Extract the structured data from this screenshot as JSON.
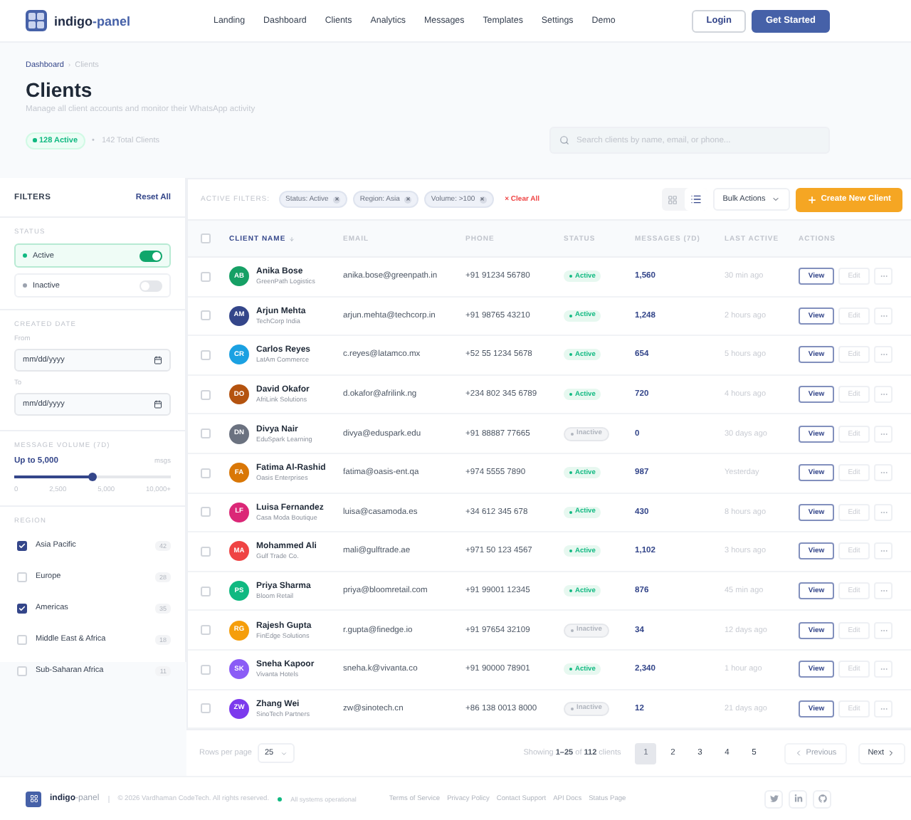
{
  "brand": {
    "first": "indigo",
    "second": "-panel"
  },
  "nav": [
    "Landing",
    "Dashboard",
    "Clients",
    "Analytics",
    "Messages",
    "Templates",
    "Settings",
    "Demo"
  ],
  "header_buttons": {
    "login": "Login",
    "start": "Get Started"
  },
  "breadcrumb": {
    "items": [
      "Dashboard",
      "Clients"
    ],
    "separator": "›"
  },
  "page": {
    "title": "Clients",
    "subtitle": "Manage all client accounts and monitor their WhatsApp activity",
    "active_badge": "128 Active",
    "dot": "•",
    "total": "142 Total Clients"
  },
  "search": {
    "placeholder": "Search clients by name, email, or phone..."
  },
  "filters": {
    "title": "FILTERS",
    "reset": "Reset All",
    "status": {
      "label": "STATUS",
      "options": [
        {
          "label": "Active",
          "on": true,
          "color": "#10b981"
        },
        {
          "label": "Inactive",
          "on": false,
          "color": "#9ca3af"
        }
      ]
    },
    "date": {
      "label": "CREATED DATE",
      "fields": [
        {
          "label": "From",
          "placeholder": "mm/dd/yyyy"
        },
        {
          "label": "To",
          "placeholder": "mm/dd/yyyy"
        }
      ]
    },
    "volume": {
      "label": "MESSAGE VOLUME (7D)",
      "value": "Up to 5,000",
      "unit": "msgs",
      "level": 0.5,
      "ticks": [
        "0",
        "2,500",
        "5,000",
        "10,000+"
      ]
    },
    "region": {
      "label": "REGION",
      "items": [
        {
          "label": "Asia Pacific",
          "checked": true,
          "count": "42"
        },
        {
          "label": "Europe",
          "checked": false,
          "count": "28"
        },
        {
          "label": "Americas",
          "checked": true,
          "count": "35"
        },
        {
          "label": "Middle East & Africa",
          "checked": false,
          "count": "18"
        },
        {
          "label": "Sub-Saharan Africa",
          "checked": false,
          "count": "11"
        }
      ]
    }
  },
  "toolbar": {
    "label": "ACTIVE FILTERS:",
    "chips": [
      "Status: Active",
      "Region: Asia",
      "Volume: >100"
    ],
    "clear": "× Clear All",
    "views": [
      {
        "kind": "grid",
        "selected": false
      },
      {
        "kind": "list",
        "selected": true
      }
    ],
    "bulk": "Bulk Actions",
    "create": "Create New Client"
  },
  "table": {
    "select_all_checked": false,
    "columns": [
      "CLIENT NAME",
      "EMAIL",
      "PHONE",
      "STATUS",
      "MESSAGES (7D)",
      "LAST ACTIVE",
      "ACTIONS"
    ],
    "rows": [
      {
        "checked": false,
        "initials": "AB",
        "color": "#16a065",
        "name": "Anika Bose",
        "company": "GreenPath Logistics",
        "email": "anika.bose@greenpath.in",
        "phone": "+91 91234 56780",
        "status": "Active",
        "active": true,
        "messages": "1,560",
        "last_active": "30 min ago",
        "view": "View",
        "edit": "Edit"
      },
      {
        "checked": false,
        "initials": "AM",
        "color": "#34468a",
        "name": "Arjun Mehta",
        "company": "TechCorp India",
        "email": "arjun.mehta@techcorp.in",
        "phone": "+91 98765 43210",
        "status": "Active",
        "active": true,
        "messages": "1,248",
        "last_active": "2 hours ago",
        "view": "View",
        "edit": "Edit"
      },
      {
        "checked": false,
        "initials": "CR",
        "color": "#1ba1e2",
        "name": "Carlos Reyes",
        "company": "LatAm Commerce",
        "email": "c.reyes@latamco.mx",
        "phone": "+52 55 1234 5678",
        "status": "Active",
        "active": true,
        "messages": "654",
        "last_active": "5 hours ago",
        "view": "View",
        "edit": "Edit"
      },
      {
        "checked": false,
        "initials": "DO",
        "color": "#b4530f",
        "name": "David Okafor",
        "company": "AfriLink Solutions",
        "email": "d.okafor@afrilink.ng",
        "phone": "+234 802 345 6789",
        "status": "Active",
        "active": true,
        "messages": "720",
        "last_active": "4 hours ago",
        "view": "View",
        "edit": "Edit"
      },
      {
        "checked": false,
        "initials": "DN",
        "color": "#6b7280",
        "name": "Divya Nair",
        "company": "EduSpark Learning",
        "email": "divya@eduspark.edu",
        "phone": "+91 88887 77665",
        "status": "Inactive",
        "active": false,
        "messages": "0",
        "last_active": "30 days ago",
        "view": "View",
        "edit": "Edit"
      },
      {
        "checked": false,
        "initials": "FA",
        "color": "#d97706",
        "name": "Fatima Al-Rashid",
        "company": "Oasis Enterprises",
        "email": "fatima@oasis-ent.qa",
        "phone": "+974 5555 7890",
        "status": "Active",
        "active": true,
        "messages": "987",
        "last_active": "Yesterday",
        "view": "View",
        "edit": "Edit"
      },
      {
        "checked": false,
        "initials": "LF",
        "color": "#db2777",
        "name": "Luisa Fernandez",
        "company": "Casa Moda Boutique",
        "email": "luisa@casamoda.es",
        "phone": "+34 612 345 678",
        "status": "Active",
        "active": true,
        "messages": "430",
        "last_active": "8 hours ago",
        "view": "View",
        "edit": "Edit"
      },
      {
        "checked": false,
        "initials": "MA",
        "color": "#ef4444",
        "name": "Mohammed Ali",
        "company": "Gulf Trade Co.",
        "email": "mali@gulftrade.ae",
        "phone": "+971 50 123 4567",
        "status": "Active",
        "active": true,
        "messages": "1,102",
        "last_active": "3 hours ago",
        "view": "View",
        "edit": "Edit"
      },
      {
        "checked": false,
        "initials": "PS",
        "color": "#10b981",
        "name": "Priya Sharma",
        "company": "Bloom Retail",
        "email": "priya@bloomretail.com",
        "phone": "+91 99001 12345",
        "status": "Active",
        "active": true,
        "messages": "876",
        "last_active": "45 min ago",
        "view": "View",
        "edit": "Edit"
      },
      {
        "checked": false,
        "initials": "RG",
        "color": "#f59e0b",
        "name": "Rajesh Gupta",
        "company": "FinEdge Solutions",
        "email": "r.gupta@finedge.io",
        "phone": "+91 97654 32109",
        "status": "Inactive",
        "active": false,
        "messages": "34",
        "last_active": "12 days ago",
        "view": "View",
        "edit": "Edit"
      },
      {
        "checked": false,
        "initials": "SK",
        "color": "#8b5cf6",
        "name": "Sneha Kapoor",
        "company": "Vivanta Hotels",
        "email": "sneha.k@vivanta.co",
        "phone": "+91 90000 78901",
        "status": "Active",
        "active": true,
        "messages": "2,340",
        "last_active": "1 hour ago",
        "view": "View",
        "edit": "Edit"
      },
      {
        "checked": false,
        "initials": "ZW",
        "color": "#7c3aed",
        "name": "Zhang Wei",
        "company": "SinoTech Partners",
        "email": "zw@sinotech.cn",
        "phone": "+86 138 0013 8000",
        "status": "Inactive",
        "active": false,
        "messages": "12",
        "last_active": "21 days ago",
        "view": "View",
        "edit": "Edit"
      }
    ]
  },
  "pagination": {
    "rows_label": "Rows per page",
    "rows_value": "25",
    "showing": "Showing **1–25** of **112** clients",
    "pages": [
      {
        "label": "1",
        "selected": true
      },
      {
        "label": "2",
        "selected": false
      },
      {
        "label": "3",
        "selected": false
      },
      {
        "label": "4",
        "selected": false
      },
      {
        "label": "5",
        "selected": false
      }
    ],
    "previous": "Previous",
    "previous_disabled": true,
    "next": "Next"
  },
  "footer": {
    "brand": {
      "first": "indigo",
      "second": "-panel"
    },
    "copyright": "© 2026 Vardhaman CodeTech. All rights reserved.",
    "status": "All systems operational",
    "links": [
      "Terms of Service",
      "Privacy Policy",
      "Contact Support",
      "API Docs",
      "Status Page"
    ]
  }
}
